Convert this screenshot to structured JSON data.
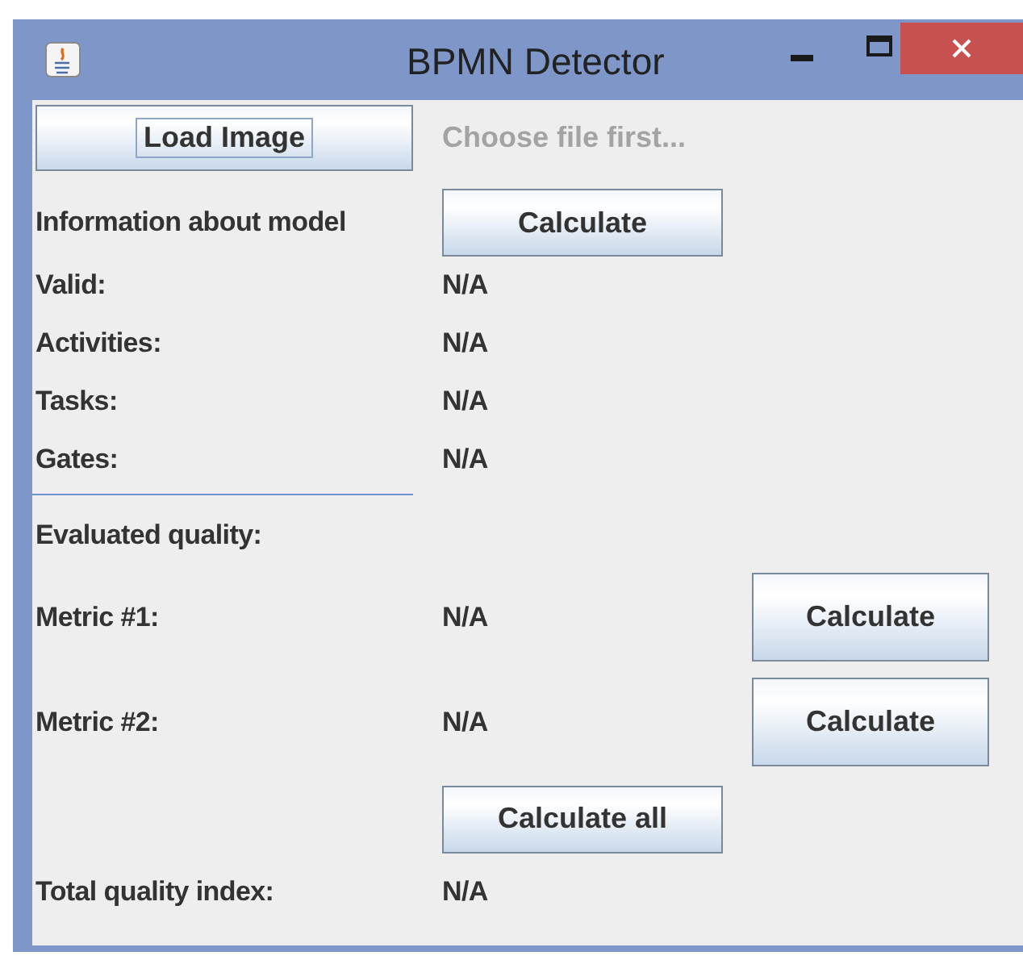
{
  "window": {
    "title": "BPMN Detector"
  },
  "load": {
    "button": "Load Image",
    "focused": true,
    "status": "Choose file first..."
  },
  "model": {
    "label": "Information about model",
    "button": "Calculate",
    "fields": [
      {
        "label": "Valid:",
        "value": "N/A"
      },
      {
        "label": "Activities:",
        "value": "N/A"
      },
      {
        "label": "Tasks:",
        "value": "N/A"
      },
      {
        "label": "Gates:",
        "value": "N/A"
      }
    ]
  },
  "quality": {
    "heading": "Evaluated quality:",
    "metrics": [
      {
        "label": "Metric #1:",
        "value": "N/A",
        "button": "Calculate"
      },
      {
        "label": "Metric #2:",
        "value": "N/A",
        "button": "Calculate"
      }
    ],
    "calculate_all": "Calculate all",
    "total": {
      "label": "Total quality index:",
      "value": "N/A"
    }
  }
}
